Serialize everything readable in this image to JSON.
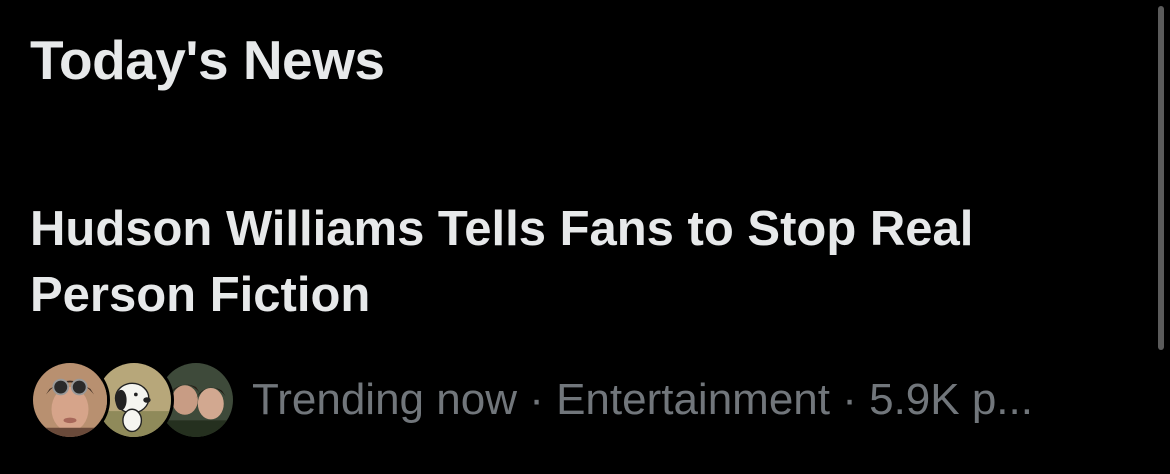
{
  "section": {
    "title": "Today's News"
  },
  "news_item": {
    "headline": "Hudson Williams Tells Fans to Stop Real Person Fiction",
    "meta": "Trending now · Entertainment · 5.9K p..."
  },
  "avatars": [
    {
      "icon": "person-with-goggles-avatar"
    },
    {
      "icon": "cartoon-dog-avatar"
    },
    {
      "icon": "two-people-avatar"
    }
  ],
  "colors": {
    "background": "#000000",
    "primary_text": "#e7e9ea",
    "secondary_text": "#71767b"
  }
}
